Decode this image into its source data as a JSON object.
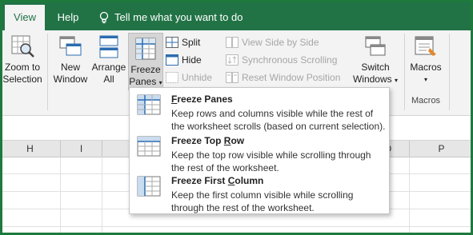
{
  "tabs": {
    "view": "View",
    "help": "Help",
    "tell_me": "Tell me what you want to do"
  },
  "ribbon": {
    "zoom_to_selection": [
      "Zoom to",
      "Selection"
    ],
    "new_window": [
      "New",
      "Window"
    ],
    "arrange_all": [
      "Arrange",
      "All"
    ],
    "freeze_panes": [
      "Freeze",
      "Panes"
    ],
    "split": "Split",
    "hide": "Hide",
    "unhide": "Unhide",
    "view_side_by_side": "View Side by Side",
    "synchronous_scrolling": "Synchronous Scrolling",
    "reset_window_position": "Reset Window Position",
    "switch_windows": [
      "Switch",
      "Windows"
    ],
    "macros": "Macros",
    "macros_group_label": "Macros"
  },
  "freeze_menu": {
    "items": [
      {
        "title_u": "F",
        "title_rest": "reeze Panes",
        "description": "Keep rows and columns visible while the rest of the worksheet scrolls (based on current selection)."
      },
      {
        "title_pre": "Freeze Top ",
        "title_u": "R",
        "title_rest": "ow",
        "description": "Keep the top row visible while scrolling through the rest of the worksheet."
      },
      {
        "title_pre": "Freeze First ",
        "title_u": "C",
        "title_rest": "olumn",
        "description": "Keep the first column visible while scrolling through the rest of the worksheet."
      }
    ]
  },
  "columns": [
    "H",
    "I",
    "O",
    "P"
  ],
  "colors": {
    "accent": "#217346",
    "ribbon_bg": "#f3f3f3",
    "disabled_text": "#a6a6a6"
  }
}
